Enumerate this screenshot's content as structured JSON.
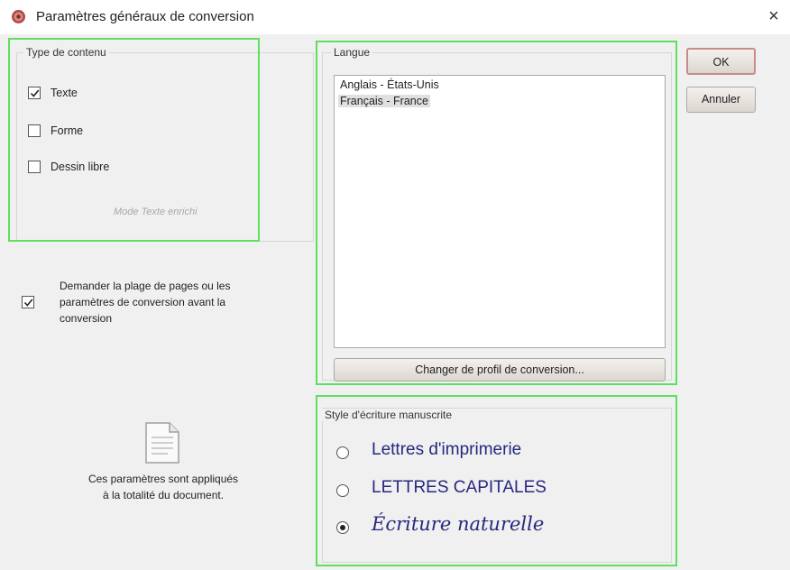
{
  "window": {
    "title": "Paramètres généraux de conversion",
    "close_glyph": "×",
    "icon": "app-gear-icon"
  },
  "content_type": {
    "group_title": "Type de contenu",
    "options": [
      {
        "label": "Texte",
        "checked": true
      },
      {
        "label": "Forme",
        "checked": false
      },
      {
        "label": "Dessin libre",
        "checked": false
      }
    ],
    "mode_label": "Mode Texte enrichi"
  },
  "ask_option": {
    "label_line1": "Demander la plage de pages ou les",
    "label_line2": "paramètres de conversion avant la",
    "label_line3": "conversion",
    "checked": true
  },
  "info": {
    "icon": "document-icon",
    "line1": "Ces paramètres sont appliqués",
    "line2": "à la totalité du document."
  },
  "language": {
    "group_title": "Langue",
    "items": [
      {
        "label": "Anglais - États-Unis",
        "selected": false
      },
      {
        "label": "Français - France",
        "selected": true
      }
    ],
    "profile_button": "Changer de profil de conversion..."
  },
  "handwriting": {
    "group_title": "Style d'écriture manuscrite",
    "options": [
      {
        "label": "Lettres d'imprimerie",
        "selected": false
      },
      {
        "label": "LETTRES CAPITALES",
        "selected": false
      },
      {
        "label": "Écriture naturelle",
        "selected": true
      }
    ]
  },
  "buttons": {
    "ok": "OK",
    "cancel": "Annuler"
  },
  "colors": {
    "highlight_border": "#5ee05e",
    "handwriting_ink": "#26287e",
    "dialog_background": "#f0f0f0"
  }
}
